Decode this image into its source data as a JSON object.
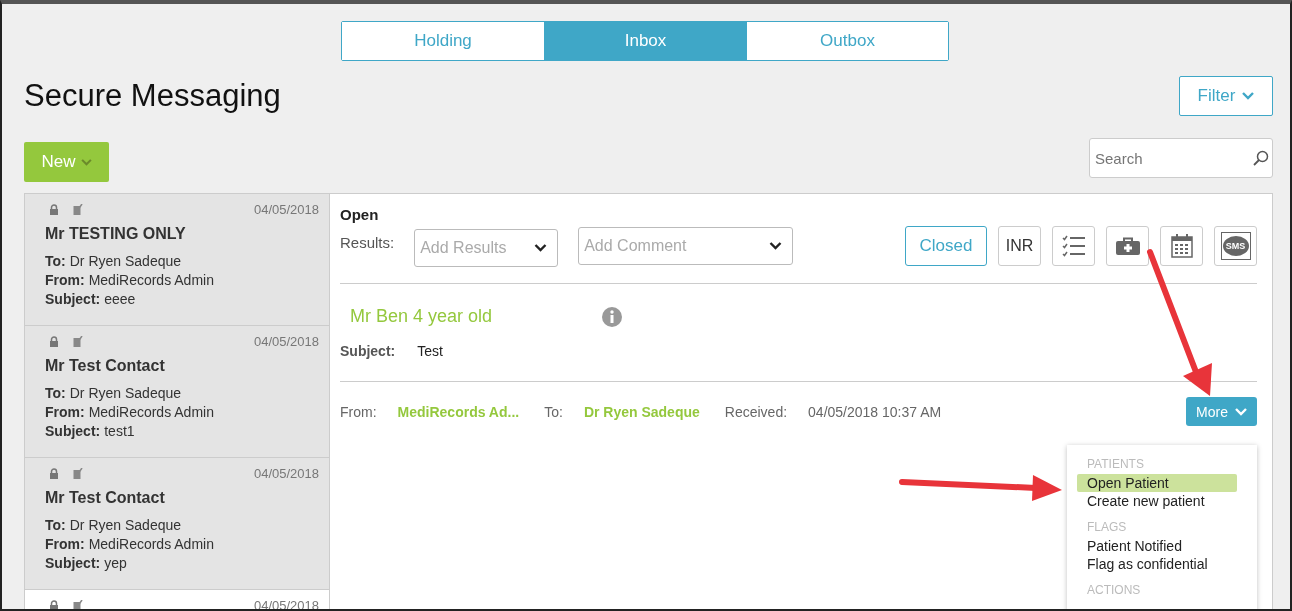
{
  "tabs": [
    {
      "label": "Holding",
      "selected": false
    },
    {
      "label": "Inbox",
      "selected": true
    },
    {
      "label": "Outbox",
      "selected": false
    }
  ],
  "title": "Secure Messaging",
  "filter_button": "Filter",
  "new_button": "New",
  "search": {
    "placeholder": "Search"
  },
  "messages": [
    {
      "date": "04/05/2018",
      "name": "Mr TESTING ONLY",
      "selected": false,
      "fields": [
        {
          "label": "To:",
          "value": "Dr Ryen Sadeque"
        },
        {
          "label": "From:",
          "value": "MediRecords Admin"
        },
        {
          "label": "Subject:",
          "value": "eeee"
        }
      ]
    },
    {
      "date": "04/05/2018",
      "name": "Mr Test Contact",
      "selected": false,
      "fields": [
        {
          "label": "To:",
          "value": "Dr Ryen Sadeque"
        },
        {
          "label": "From:",
          "value": "MediRecords Admin"
        },
        {
          "label": "Subject:",
          "value": "test1"
        }
      ]
    },
    {
      "date": "04/05/2018",
      "name": "Mr Test Contact",
      "selected": false,
      "fields": [
        {
          "label": "To:",
          "value": "Dr Ryen Sadeque"
        },
        {
          "label": "From:",
          "value": "MediRecords Admin"
        },
        {
          "label": "Subject:",
          "value": "yep"
        }
      ]
    },
    {
      "date": "04/05/2018",
      "selected": true
    }
  ],
  "detail": {
    "status": "Open",
    "results_label": "Results:",
    "results_placeholder": "Add Results",
    "comment_placeholder": "Add Comment",
    "toolbar": [
      {
        "kind": "status",
        "label": "Closed"
      },
      {
        "kind": "text",
        "label": "INR"
      },
      {
        "kind": "checklist"
      },
      {
        "kind": "medkit"
      },
      {
        "kind": "calendar"
      },
      {
        "kind": "sms",
        "label": "SMS"
      }
    ],
    "patient": "Mr Ben 4 year old",
    "subject_label": "Subject:",
    "subject": "Test",
    "meta": [
      {
        "label": "From:",
        "value": "MediRecords Ad..."
      },
      {
        "label": "To:",
        "value": "Dr Ryen Sadeque"
      }
    ],
    "received_label": "Received:",
    "received": "04/05/2018 10:37 AM",
    "more_button": "More",
    "menu": [
      {
        "heading": "PATIENTS",
        "items": [
          {
            "label": "Open Patient",
            "selected": true
          },
          {
            "label": "Create new patient",
            "selected": false
          }
        ]
      },
      {
        "heading": "FLAGS",
        "items": [
          {
            "label": "Patient Notified",
            "selected": false
          },
          {
            "label": "Flag as confidential",
            "selected": false
          }
        ]
      },
      {
        "heading": "ACTIONS"
      }
    ]
  }
}
